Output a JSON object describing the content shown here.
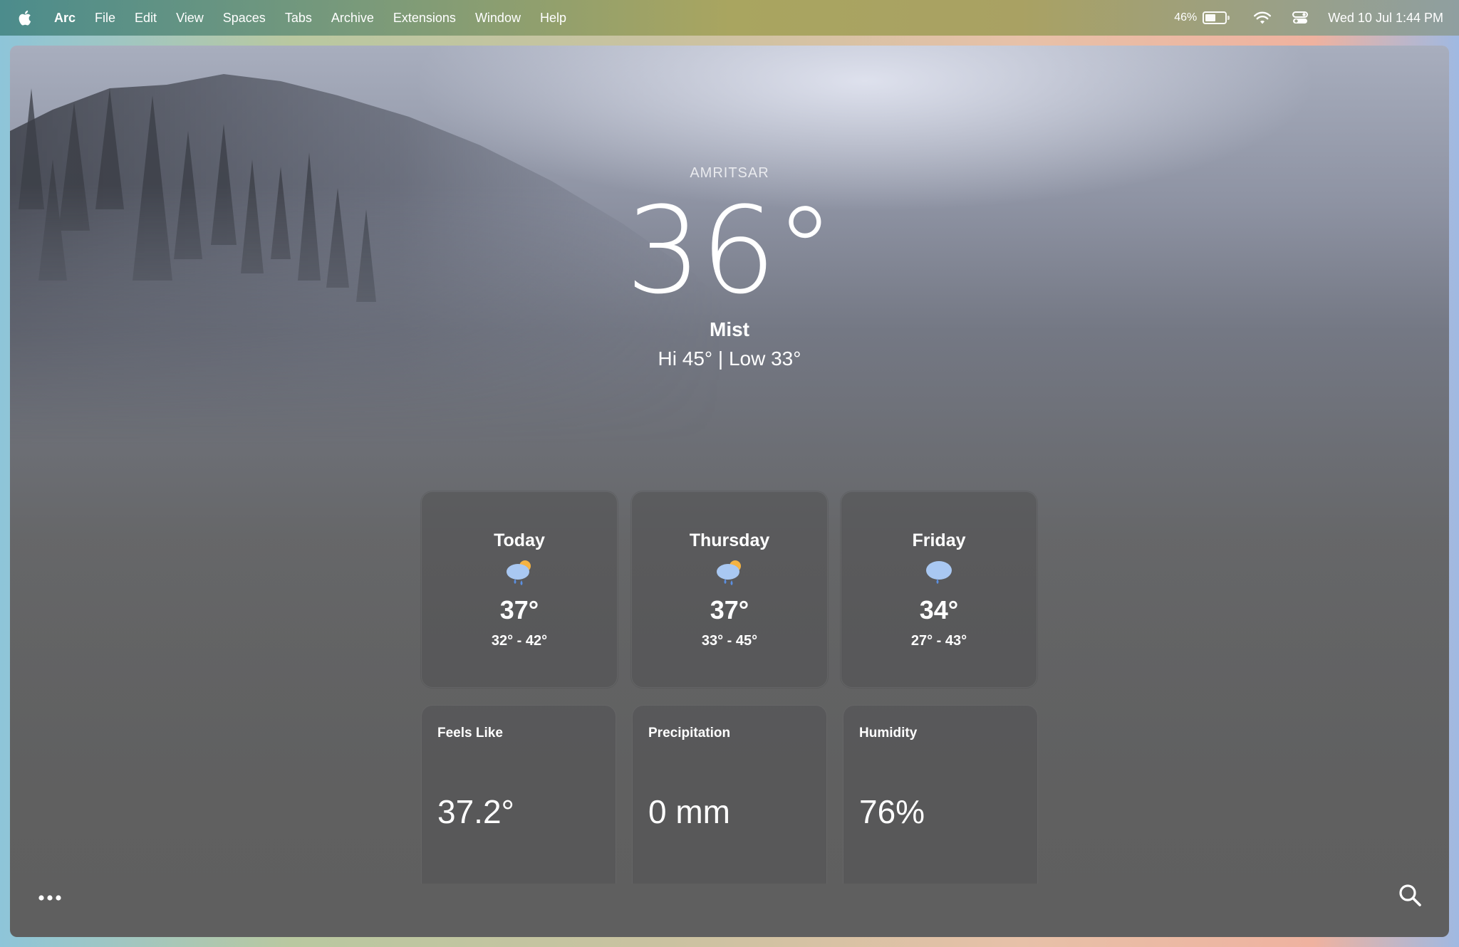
{
  "menubar": {
    "app": "Arc",
    "items": [
      "File",
      "Edit",
      "View",
      "Spaces",
      "Tabs",
      "Archive",
      "Extensions",
      "Window",
      "Help"
    ],
    "battery": "46%",
    "battery_level": 0.46,
    "datetime": "Wed 10 Jul  1:44 PM"
  },
  "weather": {
    "city": "AMRITSAR",
    "temp": "36°",
    "condition": "Mist",
    "hilo": "Hi 45° | Low 33°"
  },
  "forecast": [
    {
      "day": "Today",
      "icon": "partly-sunny-rain-icon",
      "temp": "37°",
      "range": "32° - 42°"
    },
    {
      "day": "Thursday",
      "icon": "partly-sunny-rain-icon",
      "temp": "37°",
      "range": "33° - 45°"
    },
    {
      "day": "Friday",
      "icon": "rain-cloud-icon",
      "temp": "34°",
      "range": "27° - 43°"
    }
  ],
  "stats": [
    {
      "label": "Feels Like",
      "value": "37.2°"
    },
    {
      "label": "Precipitation",
      "value": "0 mm"
    },
    {
      "label": "Humidity",
      "value": "76%"
    }
  ],
  "icons": {
    "more": "more-dots-icon",
    "search": "search-icon"
  },
  "colors": {
    "sun": "#f5b342",
    "cloud": "#a9c8f2",
    "drop": "#5b8fe0"
  }
}
